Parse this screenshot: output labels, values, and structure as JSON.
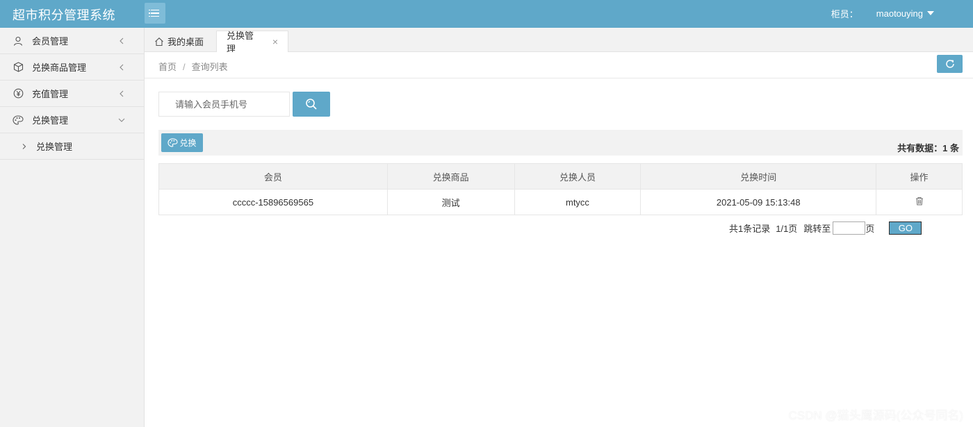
{
  "header": {
    "app_title": "超市积分管理系统",
    "role_label": "柜员：",
    "username": "maotouying"
  },
  "sidebar": {
    "items": [
      {
        "label": "会员管理",
        "icon": "user-icon",
        "expanded": false
      },
      {
        "label": "兑换商品管理",
        "icon": "box-icon",
        "expanded": false
      },
      {
        "label": "充值管理",
        "icon": "yen-icon",
        "expanded": false
      },
      {
        "label": "兑换管理",
        "icon": "palette-icon",
        "expanded": true
      }
    ],
    "sub_items": [
      {
        "label": "兑换管理"
      }
    ]
  },
  "tabs": [
    {
      "label": "我的桌面",
      "icon": "home-icon"
    },
    {
      "label": "兑换管理",
      "active": true,
      "close": "×"
    }
  ],
  "breadcrumb": {
    "home": "首页",
    "separator": "/",
    "current": "查询列表"
  },
  "search": {
    "placeholder": "请输入会员手机号",
    "value": ""
  },
  "toolbar": {
    "exchange_label": "兑换",
    "total_text": "共有数据：1 条"
  },
  "table": {
    "columns": [
      "会员",
      "兑换商品",
      "兑换人员",
      "兑换时间",
      "操作"
    ],
    "rows": [
      {
        "member": "ccccc-15896569565",
        "product": "测试",
        "operator": "mtycc",
        "time": "2021-05-09 15:13:48",
        "action_icon": "trash-icon"
      }
    ]
  },
  "pager": {
    "records_text": "共1条记录",
    "pages_text": "1/1页",
    "jump_label": "跳转至",
    "page_suffix": "页",
    "go_label": "GO",
    "jump_value": ""
  },
  "watermark": "CSDN @猫头鹰源码(公众号同名)",
  "colors": {
    "primary": "#5fa8c9",
    "sidebar_bg": "#f2f2f2",
    "border": "#e2e2e2"
  }
}
